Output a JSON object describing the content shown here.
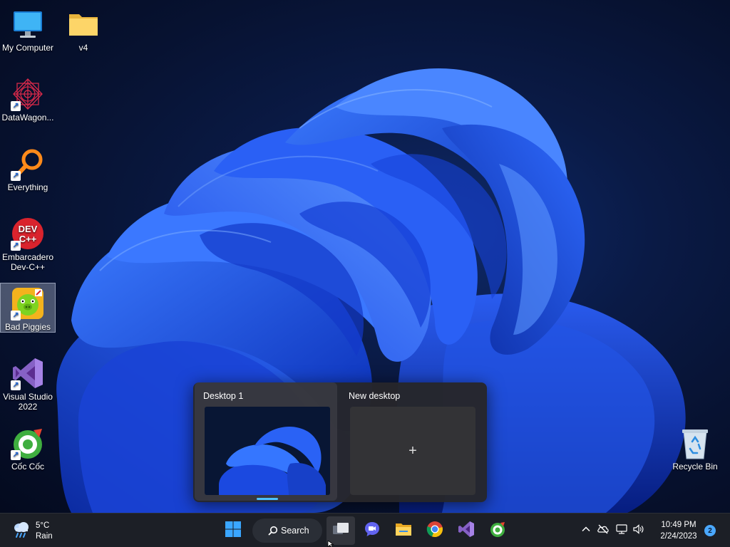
{
  "desktop": {
    "icons": [
      {
        "label": "My Computer",
        "icon": "monitor-icon"
      },
      {
        "label": "v4",
        "icon": "folder-icon"
      },
      {
        "label": "DataWagon...",
        "icon": "datawagon-icon"
      },
      {
        "label": "Everything",
        "icon": "magnifier-icon"
      },
      {
        "label": "Embarcadero Dev-C++",
        "icon": "devcpp-icon",
        "logo_text": "DEV C++"
      },
      {
        "label": "Bad Piggies",
        "icon": "bad-piggies-icon"
      },
      {
        "label": "Visual Studio 2022",
        "icon": "visual-studio-icon"
      },
      {
        "label": "Cốc Cốc",
        "icon": "coccoc-icon"
      },
      {
        "label": "Recycle Bin",
        "icon": "recycle-bin-icon"
      }
    ],
    "selected_icon": "Bad Piggies"
  },
  "task_view": {
    "desktops": [
      {
        "title": "Desktop 1",
        "current": true
      },
      {
        "title": "New desktop",
        "plus": "+"
      }
    ]
  },
  "taskbar": {
    "weather": {
      "temperature": "5°C",
      "condition": "Rain",
      "icon": "cloud-rain-icon"
    },
    "search_label": "Search",
    "apps": [
      {
        "name": "start",
        "icon": "windows-logo-icon"
      },
      {
        "name": "task-view",
        "icon": "task-view-icon",
        "active": true
      },
      {
        "name": "teams-chat",
        "icon": "chat-icon"
      },
      {
        "name": "file-explorer",
        "icon": "folder-icon"
      },
      {
        "name": "chrome",
        "icon": "chrome-icon"
      },
      {
        "name": "visual-studio",
        "icon": "visual-studio-icon"
      },
      {
        "name": "coccoc",
        "icon": "coccoc-icon"
      }
    ],
    "tray": {
      "icons": [
        "chevron-up-icon",
        "onedrive-offline-icon",
        "network-icon",
        "volume-icon"
      ],
      "time": "10:49 PM",
      "date": "2/24/2023",
      "notification_count": "2"
    }
  },
  "colors": {
    "taskbar_bg": "#1c1f26",
    "accent": "#4cc2ff",
    "wallpaper_blue": "#1f4fe0"
  }
}
